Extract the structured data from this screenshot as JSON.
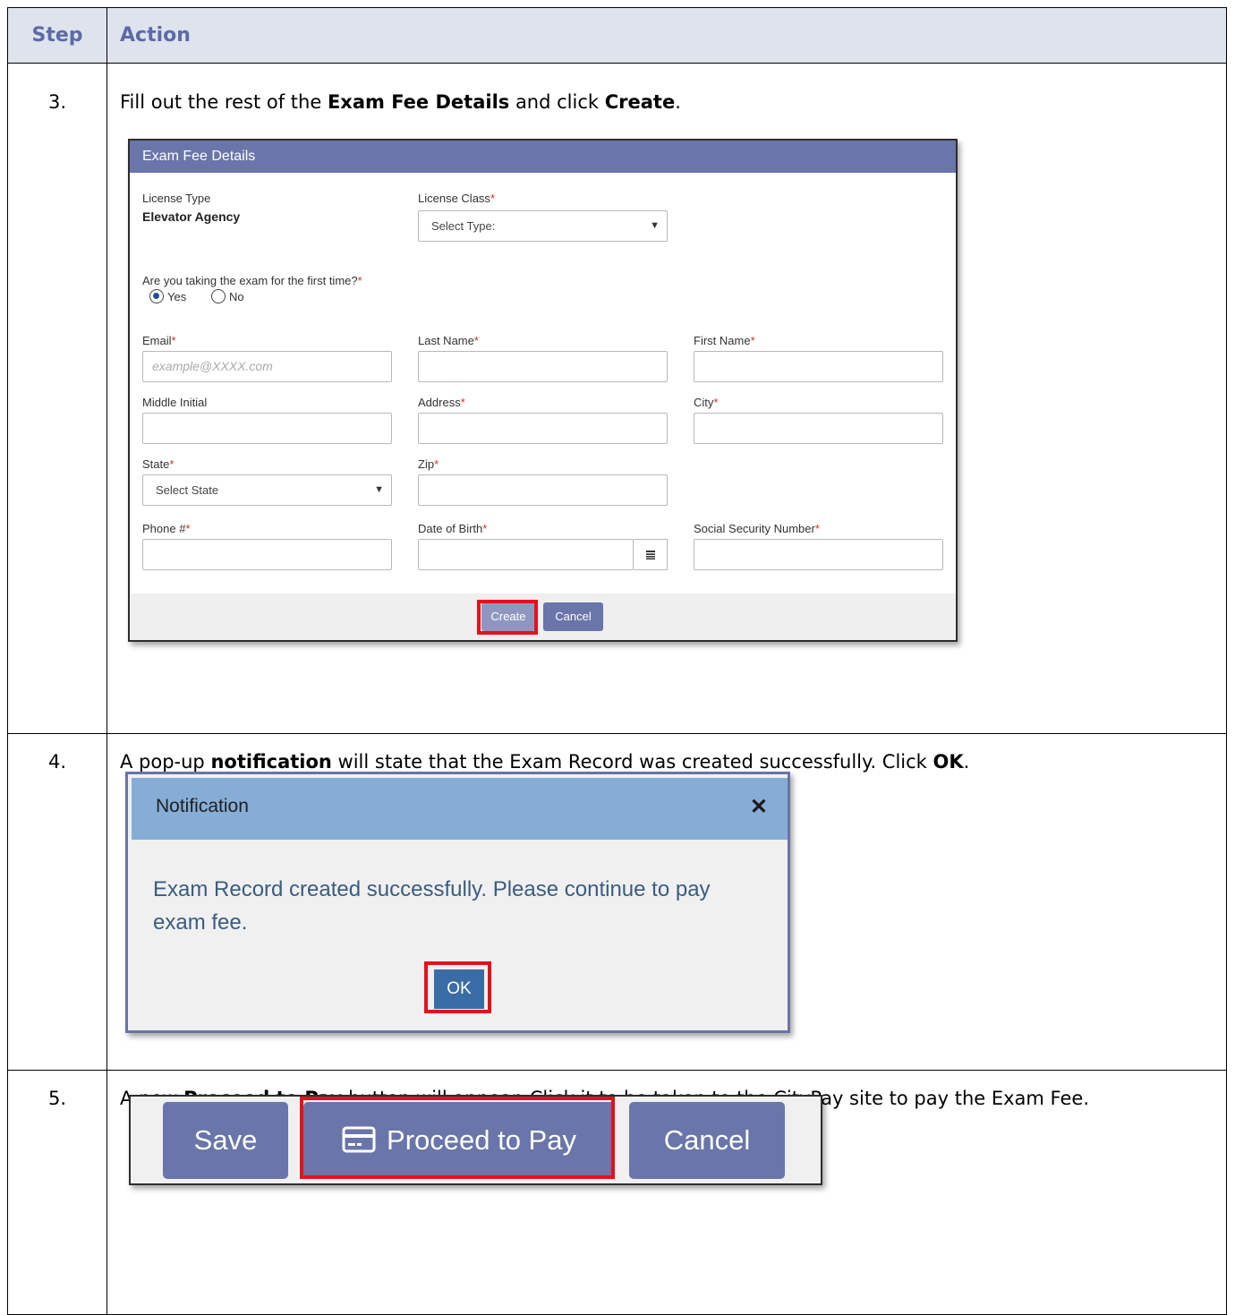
{
  "table": {
    "header_step": "Step",
    "header_action": "Action"
  },
  "steps": [
    {
      "number": "3.",
      "text_before": "Fill out the rest of the ",
      "bold1": "Exam Fee Details",
      "text_middle": " and click ",
      "bold2": "Create",
      "text_after": "."
    },
    {
      "number": "4.",
      "text_before": "A pop-up ",
      "bold1": "notification",
      "text_middle": " will state that the Exam Record was created successfully. Click ",
      "bold2": "OK",
      "text_after": "."
    },
    {
      "number": "5.",
      "text_before": "A new ",
      "bold1": "Proceed to Pay",
      "text_after": " button will appear. Click it to be taken to the CityPay site to pay the Exam Fee."
    }
  ],
  "exam_form": {
    "title": "Exam Fee Details",
    "license_type_label": "License Type",
    "license_type_value": "Elevator Agency",
    "license_class_label": "License Class",
    "license_class_selected": "Select Type:",
    "first_time_question": "Are you taking the exam for the first time?",
    "radio_yes": "Yes",
    "radio_no": "No",
    "email_label": "Email",
    "email_placeholder": "example@XXXX.com",
    "last_name_label": "Last Name",
    "first_name_label": "First Name",
    "middle_initial_label": "Middle Initial",
    "address_label": "Address",
    "city_label": "City",
    "state_label": "State",
    "state_selected": "Select State",
    "zip_label": "Zip",
    "phone_label": "Phone #",
    "dob_label": "Date of Birth",
    "ssn_label": "Social Security Number",
    "required_mark": "*",
    "create_label": "Create",
    "cancel_label": "Cancel"
  },
  "notification": {
    "title": "Notification",
    "close_glyph": "✕",
    "message": "Exam Record created successfully. Please continue to pay exam fee.",
    "ok_label": "OK"
  },
  "pay_toolbar": {
    "save_label": "Save",
    "proceed_label": "Proceed to Pay",
    "cancel_label": "Cancel"
  },
  "colors": {
    "header_blue": "#6a75a9",
    "highlight_red": "#e4111b",
    "notification_header": "#86add6",
    "required_red": "#d32f2f"
  },
  "icons": [
    "chevron-down-icon",
    "calendar-icon",
    "close-icon",
    "credit-card-icon"
  ]
}
